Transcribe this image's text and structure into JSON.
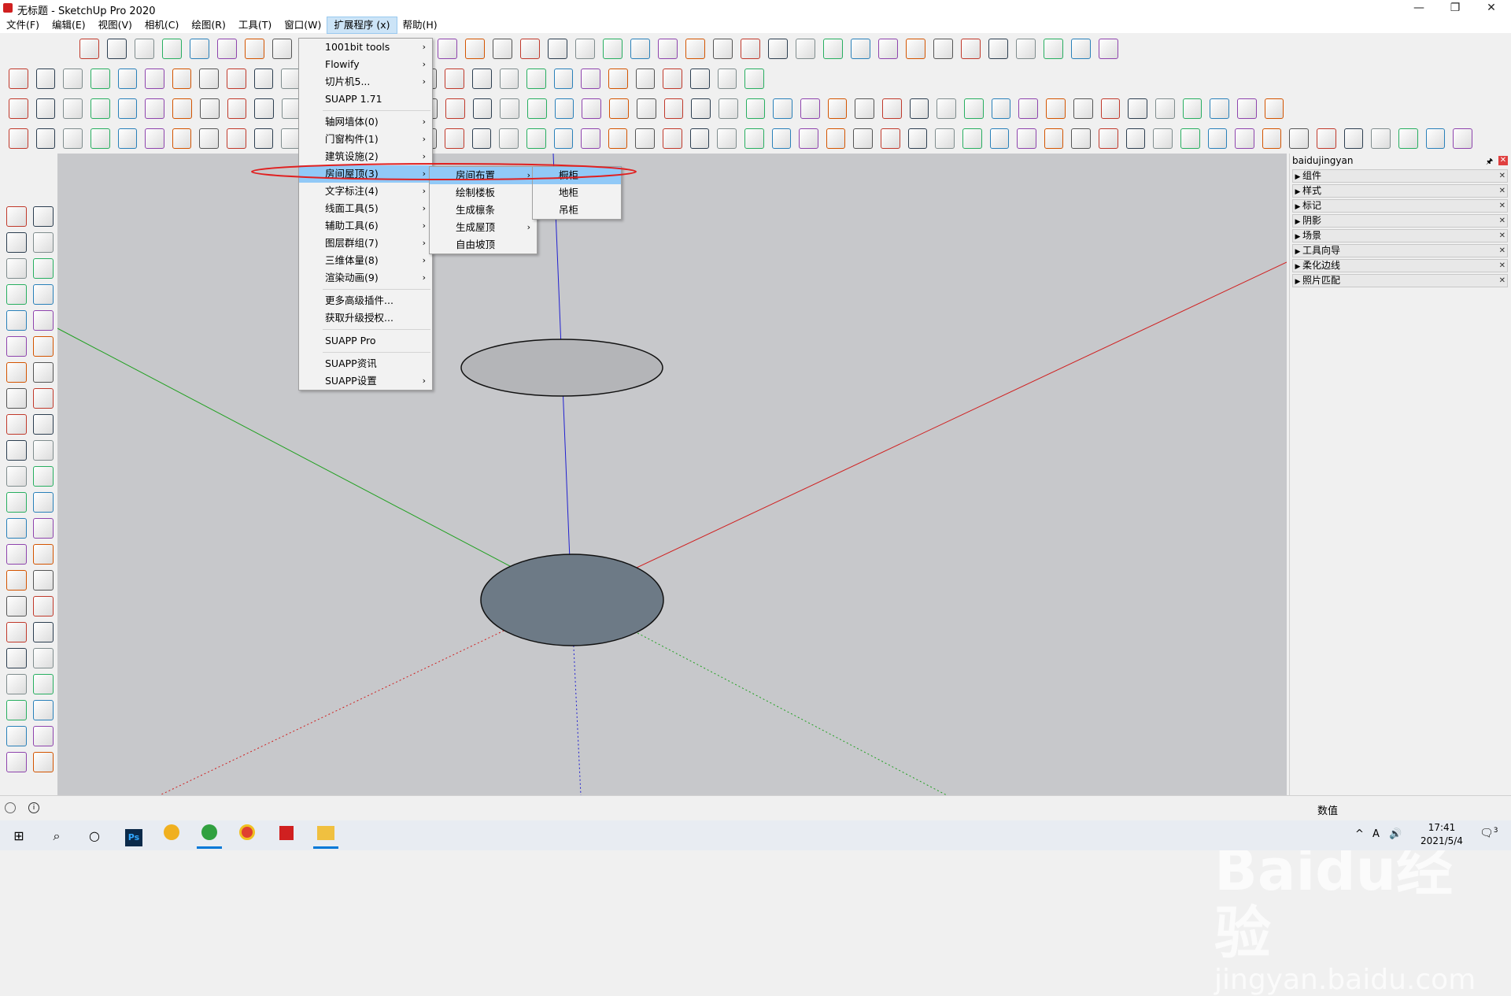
{
  "window": {
    "title": "无标题 - SketchUp Pro 2020",
    "min": "—",
    "restore": "❐",
    "close": "✕"
  },
  "menubar": [
    "文件(F)",
    "编辑(E)",
    "视图(V)",
    "相机(C)",
    "绘图(R)",
    "工具(T)",
    "窗口(W)",
    "扩展程序 (x)",
    "帮助(H)"
  ],
  "ext_menu": {
    "items": [
      {
        "label": "1001bit tools",
        "sub": true
      },
      {
        "label": "Flowify",
        "sub": true
      },
      {
        "label": "切片机5...",
        "sub": true
      },
      {
        "label": "SUAPP 1.71",
        "sub": false
      },
      {
        "sep": true
      },
      {
        "label": "轴网墙体(0)",
        "sub": true
      },
      {
        "label": "门窗构件(1)",
        "sub": true
      },
      {
        "label": "建筑设施(2)",
        "sub": true
      },
      {
        "label": "房间屋顶(3)",
        "sub": true,
        "hl": true
      },
      {
        "label": "文字标注(4)",
        "sub": true
      },
      {
        "label": "线面工具(5)",
        "sub": true
      },
      {
        "label": "辅助工具(6)",
        "sub": true
      },
      {
        "label": "图层群组(7)",
        "sub": true
      },
      {
        "label": "三维体量(8)",
        "sub": true
      },
      {
        "label": "渲染动画(9)",
        "sub": true
      },
      {
        "sep": true
      },
      {
        "label": "更多高级插件...",
        "sub": false
      },
      {
        "label": "获取升级授权...",
        "sub": false
      },
      {
        "sep": true
      },
      {
        "label": "SUAPP Pro",
        "sub": false
      },
      {
        "sep": true
      },
      {
        "label": "SUAPP资讯",
        "sub": false
      },
      {
        "label": "SUAPP设置",
        "sub": true
      }
    ]
  },
  "room_menu": {
    "items": [
      {
        "label": "房间布置",
        "sub": true,
        "hl": true
      },
      {
        "label": "绘制楼板",
        "sub": false
      },
      {
        "label": "生成檩条",
        "sub": false
      },
      {
        "label": "生成屋顶",
        "sub": true
      },
      {
        "label": "自由坡顶",
        "sub": false
      }
    ]
  },
  "layout_menu": {
    "items": [
      {
        "label": "橱柜",
        "hl": true
      },
      {
        "label": "地柜"
      },
      {
        "label": "吊柜"
      }
    ]
  },
  "tray": {
    "title": "baidujingyan",
    "panels": [
      "组件",
      "样式",
      "标记",
      "阴影",
      "场景",
      "工具向导",
      "柔化边线",
      "照片匹配"
    ]
  },
  "status": {
    "measure_label": "数值"
  },
  "taskbar": {
    "time": "17:41",
    "date": "2021/5/4",
    "notif_count": "3",
    "ime": "A"
  },
  "watermark": {
    "logo": "Baidu经验",
    "url": "jingyan.baidu.com"
  },
  "colors": {
    "highlight": "#91c9f7",
    "circle_annotation": "#e02020",
    "axis_red": "#d02020",
    "axis_green": "#20a020",
    "axis_blue": "#2020d0"
  }
}
